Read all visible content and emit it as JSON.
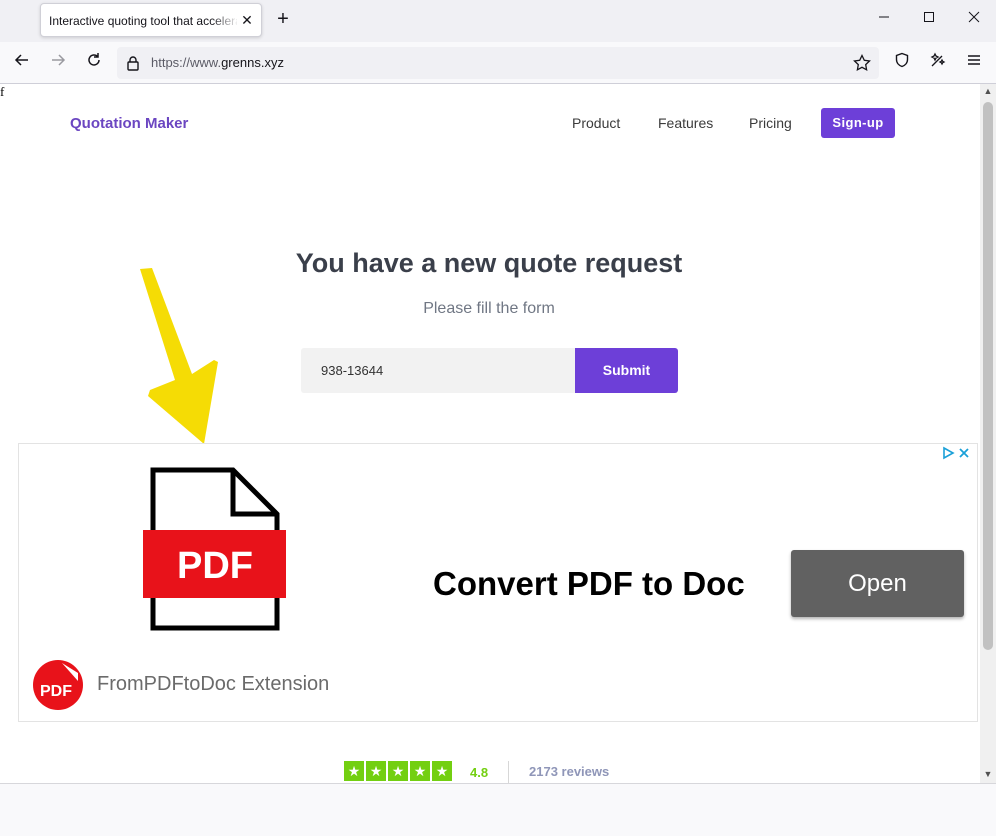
{
  "browser": {
    "tab_title": "Interactive quoting tool that accelerates",
    "tab_close": "✕",
    "new_tab": "+",
    "url_scheme": "https://www.",
    "url_host": "grenns.xyz"
  },
  "page": {
    "stray_char": "f",
    "brand": "Quotation Maker",
    "nav": {
      "product": "Product",
      "features": "Features",
      "pricing": "Pricing",
      "signup": "Sign-up"
    },
    "hero": {
      "title": "You have a new quote request",
      "subtitle": "Please fill the form"
    },
    "form": {
      "input_value": "938-13644",
      "submit": "Submit"
    },
    "ad": {
      "pdf_label": "PDF",
      "headline": "Convert PDF to Doc",
      "open_button": "Open",
      "advertiser": "FromPDFtoDoc Extension",
      "advertiser_logo_text": "PDF"
    },
    "rating": {
      "score": "4.8",
      "reviews": "2173 reviews"
    }
  },
  "colors": {
    "accent": "#6d3fd8",
    "brand": "#6b46c1",
    "star_green": "#73cf11",
    "pdf_red": "#e8121a",
    "arrow_yellow": "#f5dc05",
    "ad_button": "#616161"
  },
  "icons": [
    "back-arrow-icon",
    "forward-arrow-icon",
    "reload-icon",
    "lock-icon",
    "bookmark-star-icon",
    "shield-icon",
    "extensions-icon",
    "menu-icon",
    "pdf-document-icon",
    "adchoices-icon"
  ]
}
